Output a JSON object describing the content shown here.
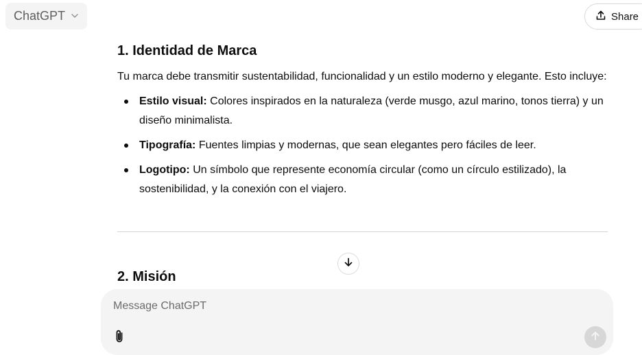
{
  "header": {
    "model_label": "ChatGPT",
    "share_label": "Share"
  },
  "section1": {
    "heading": "1. Identidad de Marca",
    "intro": "Tu marca debe transmitir sustentabilidad, funcionalidad y un estilo moderno y elegante. Esto incluye:",
    "bullets": [
      {
        "term": "Estilo visual:",
        "text": " Colores inspirados en la naturaleza (verde musgo, azul marino, tonos tierra) y un diseño minimalista."
      },
      {
        "term": "Tipografía:",
        "text": " Fuentes limpias y modernas, que sean elegantes pero fáciles de leer."
      },
      {
        "term": "Logotipo:",
        "text": " Un símbolo que represente economía circular (como un círculo estilizado), la sostenibilidad, y la conexión con el viajero."
      }
    ]
  },
  "section2": {
    "heading": "2. Misión"
  },
  "composer": {
    "placeholder": "Message ChatGPT"
  },
  "icons": {
    "model_dropdown": "chevron-down-icon",
    "share": "share-icon",
    "scroll_down": "arrow-down-icon",
    "attach": "paperclip-icon",
    "send": "arrow-up-icon"
  }
}
